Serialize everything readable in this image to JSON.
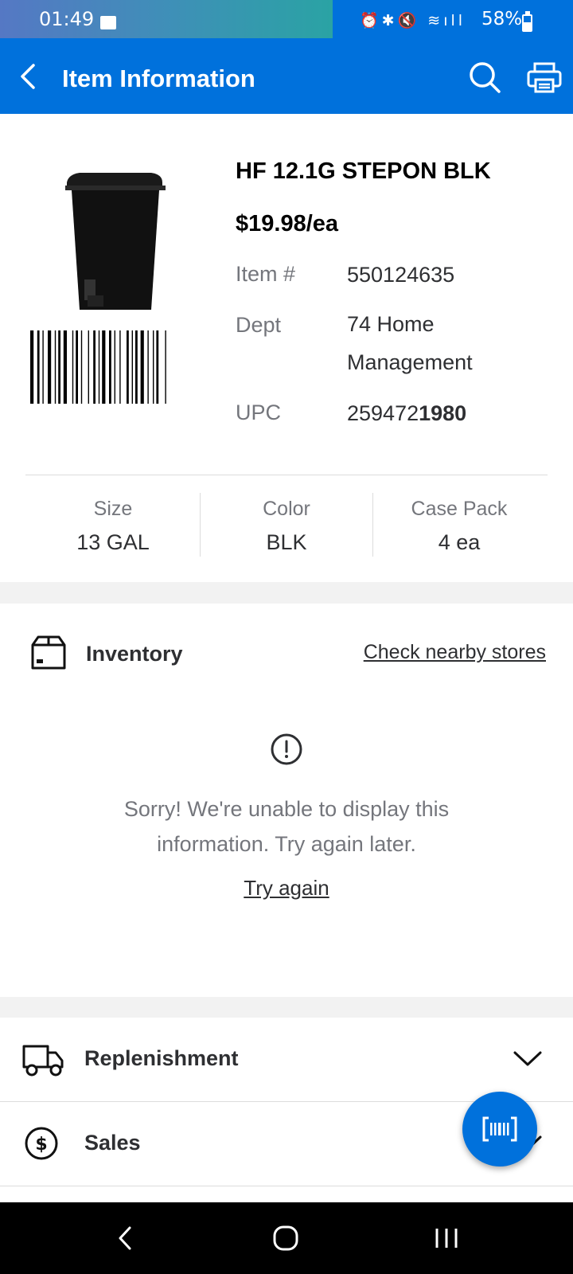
{
  "status_bar": {
    "time": "01:49",
    "battery": "58%"
  },
  "header": {
    "title": "Item Information"
  },
  "item": {
    "name": "HF 12.1G STEPON BLK",
    "price": "$19.98/ea",
    "item_number_label": "Item #",
    "item_number": "550124635",
    "dept_label": "Dept",
    "dept_line1": "74 Home",
    "dept_line2": "Management",
    "upc_label": "UPC",
    "upc_prefix": "259472",
    "upc_suffix": "1980",
    "attributes": [
      {
        "label": "Size",
        "value": "13 GAL"
      },
      {
        "label": "Color",
        "value": "BLK"
      },
      {
        "label": "Case Pack",
        "value": "4 ea"
      }
    ]
  },
  "inventory": {
    "title": "Inventory",
    "check_link": "Check nearby stores",
    "error_line1": "Sorry! We're unable to display this",
    "error_line2": "information. Try again later.",
    "try_again": "Try again"
  },
  "sections": [
    {
      "label": "Replenishment",
      "icon": "truck-icon"
    },
    {
      "label": "Sales",
      "icon": "dollar-icon"
    }
  ],
  "colors": {
    "brand_blue": "#0071dc",
    "text": "#2e2f32",
    "muted": "#74767c"
  }
}
